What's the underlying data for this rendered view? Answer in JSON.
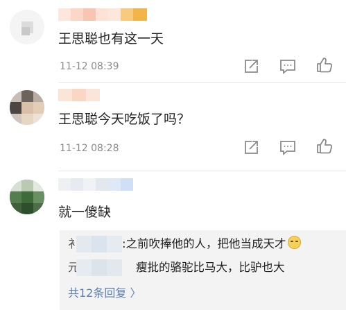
{
  "comments": [
    {
      "text": "王思聪也有这一天",
      "time": "11-12 08:39"
    },
    {
      "text": "王思聪今天吃饭了吗？",
      "time": "11-12 08:28"
    },
    {
      "text": "就一傻缺",
      "replies": [
        {
          "prefix": "衤",
          "text": ":之前吹捧他的人，把他当成天才"
        },
        {
          "prefix": "元",
          "text": "瘦批的骆驼比马大，比驴也大"
        }
      ],
      "more_replies_label": "共12条回复 〉"
    }
  ],
  "icons": {
    "share": "share-icon",
    "comment": "comment-icon",
    "like": "thumbs-up-icon",
    "emoji": "smirk-emoji-icon"
  },
  "colors": {
    "time": "#8a8a8a",
    "link": "#5b7fb5",
    "reply_bg": "#f3f3f3",
    "icon": "#8a8a8a"
  }
}
